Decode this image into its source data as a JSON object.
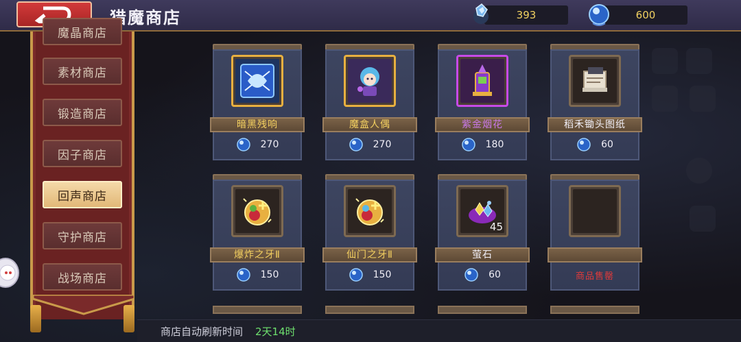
{
  "header": {
    "title": "猎魔商店",
    "currency_1": "393",
    "currency_2": "600"
  },
  "sidebar": {
    "items": [
      {
        "label": "魔晶商店"
      },
      {
        "label": "素材商店"
      },
      {
        "label": "锻造商店"
      },
      {
        "label": "因子商店"
      },
      {
        "label": "回声商店",
        "active": true
      },
      {
        "label": "守护商店"
      },
      {
        "label": "战场商店"
      }
    ]
  },
  "shop": {
    "items": [
      {
        "name": "暗黑残响",
        "price": "270",
        "name_color": "#f4d060",
        "icon": "dark-echo-icon"
      },
      {
        "name": "魔盒人偶",
        "price": "270",
        "name_color": "#f4d060",
        "icon": "magic-box-doll-icon"
      },
      {
        "name": "紫金烟花",
        "price": "180",
        "name_color": "#c878e8",
        "icon": "purple-gold-firework-icon"
      },
      {
        "name": "稻禾锄头图纸",
        "price": "60",
        "name_color": "#f0eef6",
        "icon": "hoe-blueprint-icon"
      },
      {
        "name": "爆炸之牙Ⅱ",
        "price": "150",
        "name_color": "#f4d060",
        "icon": "explosion-fang-icon"
      },
      {
        "name": "仙门之牙Ⅱ",
        "price": "150",
        "name_color": "#f4d060",
        "icon": "immortal-gate-fang-icon"
      },
      {
        "name": "萤石",
        "price": "60",
        "quantity": "45",
        "name_color": "#f0eef6",
        "icon": "fluorite-icon"
      },
      {
        "name": "",
        "price": "",
        "status": "商品售罄",
        "icon": "empty-slot-icon"
      }
    ]
  },
  "footer": {
    "refresh_label": "商店自动刷新时间",
    "refresh_value": "2天14时"
  },
  "colors": {
    "accent_red": "#d23a3a",
    "gold_text": "#f4d060",
    "purple_text": "#c878e8",
    "sold_out": "#e03a3a",
    "timer_green": "#6ee06e"
  }
}
